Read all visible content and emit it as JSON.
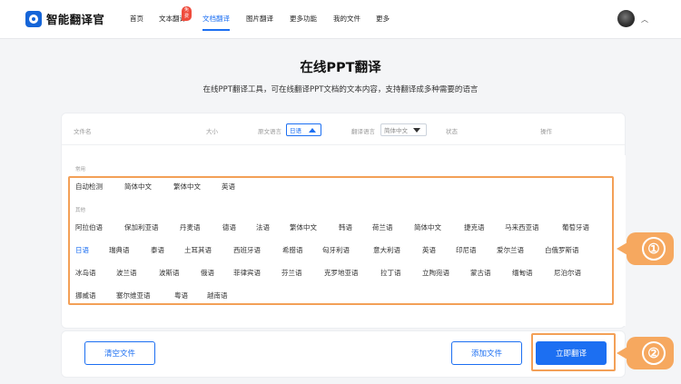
{
  "header": {
    "logo_text": "智能翻译官",
    "nav": [
      "首页",
      "文本翻译",
      "文档翻译",
      "图片翻译",
      "更多功能",
      "我的文件",
      "更多"
    ],
    "badge": "免费",
    "active_nav": "文档翻译"
  },
  "page": {
    "title": "在线PPT翻译",
    "subtitle": "在线PPT翻译工具，可在线翻译PPT文档的文本内容，支持翻译成多种需要的语言"
  },
  "table": {
    "col_filename": "文件名",
    "col_size": "大小",
    "col_source_lang": "原文语言",
    "source_lang_value": "日语",
    "col_target_lang": "翻译语言",
    "target_lang_value": "简体中文",
    "col_status": "状态",
    "col_action": "操作"
  },
  "languages": {
    "common_label": "常用",
    "common": [
      "自动检测",
      "简体中文",
      "繁体中文",
      "英语"
    ],
    "other_label": "其他",
    "row1": [
      "阿拉伯语",
      "保加利亚语",
      "丹麦语",
      "德语",
      "法语",
      "繁体中文",
      "韩语",
      "荷兰语",
      "简体中文",
      "捷克语",
      "马来西亚语",
      "葡萄牙语"
    ],
    "row2": [
      "日语",
      "瑞典语",
      "泰语",
      "土耳其语",
      "西班牙语",
      "希腊语",
      "匈牙利语",
      "意大利语",
      "英语",
      "印尼语",
      "爱尔兰语",
      "白俄罗斯语"
    ],
    "row3": [
      "冰岛语",
      "波兰语",
      "波斯语",
      "俄语",
      "菲律宾语",
      "芬兰语",
      "克罗地亚语",
      "拉丁语",
      "立陶宛语",
      "蒙古语",
      "缅甸语",
      "尼泊尔语"
    ],
    "row4": [
      "挪威语",
      "塞尔维亚语",
      "粤语",
      "越南语"
    ],
    "selected": "日语"
  },
  "actions": {
    "clear": "清空文件",
    "add": "添加文件",
    "translate": "立即翻译"
  },
  "markers": {
    "one": "①",
    "two": "②"
  },
  "colors": {
    "accent": "#1c6ff2",
    "highlight": "#f3a057",
    "badge": "#ef4b3c"
  }
}
